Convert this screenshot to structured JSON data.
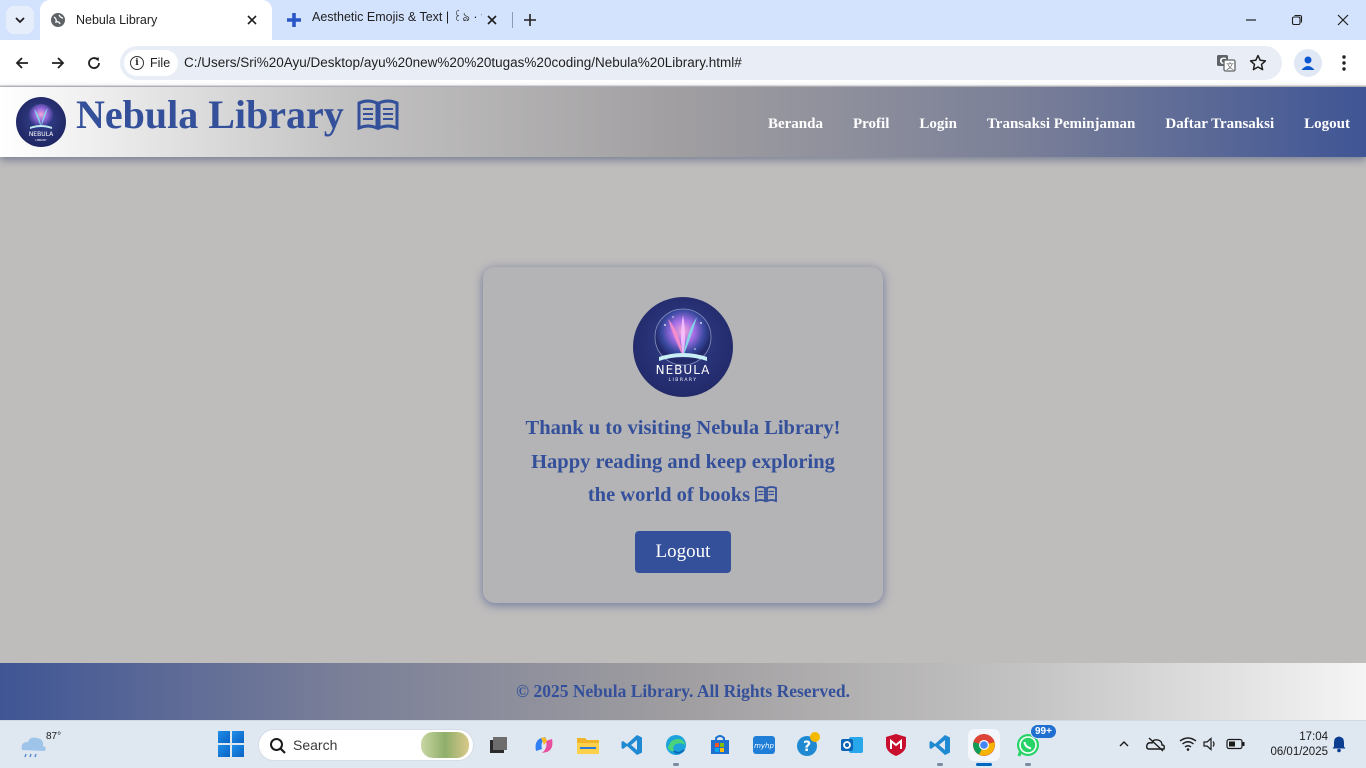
{
  "browser": {
    "tabs": [
      {
        "title": "Nebula Library",
        "active": true
      },
      {
        "title": "Aesthetic Emojis & Text | ꒰ঌ · ༉",
        "active": false
      }
    ],
    "omnibox": {
      "scheme_label": "File",
      "url": "C:/Users/Sri%20Ayu/Desktop/ayu%20new%20%20tugas%20coding/Nebula%20Library.html#"
    }
  },
  "site": {
    "title": "Nebula Library",
    "logo_text": "NEBULA",
    "logo_subtext": "LIBRARY",
    "nav": [
      {
        "label": "Beranda"
      },
      {
        "label": "Profil"
      },
      {
        "label": "Login"
      },
      {
        "label": "Transaksi Peminjaman"
      },
      {
        "label": "Daftar Transaksi"
      },
      {
        "label": "Logout"
      }
    ],
    "brand_color": "#34509a"
  },
  "card": {
    "logo_text": "NEBULA",
    "logo_subtext": "LIBRARY",
    "line1": "Thank u to visiting Nebula Library!",
    "line2": "Happy reading and keep exploring",
    "line3": "the world of books",
    "button_label": "Logout"
  },
  "footer": {
    "text": "© 2025 Nebula Library. All Rights Reserved."
  },
  "taskbar": {
    "weather_temp": "87°",
    "search_placeholder": "Search",
    "whatsapp_badge": "99+",
    "time": "17:04",
    "date": "06/01/2025"
  }
}
